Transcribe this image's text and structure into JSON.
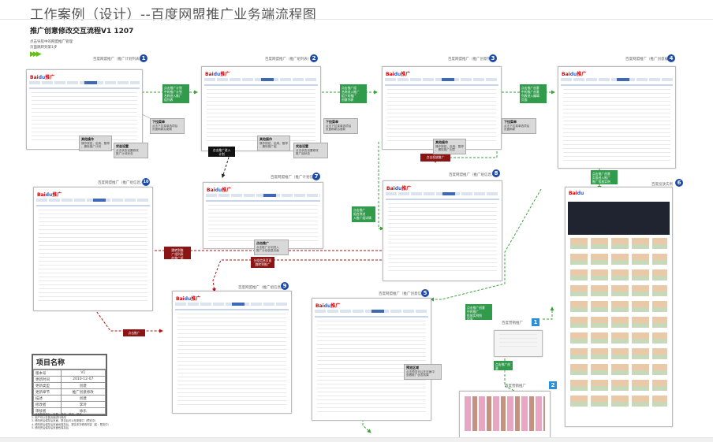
{
  "page": {
    "title": "工作案例（设计）--百度网盟推广业务端流程图",
    "subtitle": "推广创意修改交互流程V1  1207",
    "hint_line1": "点击导航中的网盟推广管理",
    "hint_line2": "页面跳转到第1步",
    "legend_arrows": "▶▶▶"
  },
  "screens": [
    {
      "id": "s1",
      "badge": "1",
      "caption": "百度网盟推广（推广计划列表）"
    },
    {
      "id": "s2",
      "badge": "2",
      "caption": "百度网盟推广（推广组列表）"
    },
    {
      "id": "s3",
      "badge": "3",
      "caption": "百度网盟推广（推广创意列表）"
    },
    {
      "id": "s4",
      "badge": "4",
      "caption": "百度网盟推广（推广创意编辑）"
    },
    {
      "id": "s6",
      "badge": "6",
      "caption": "百度投放实例"
    },
    {
      "id": "s7",
      "badge": "7",
      "caption": "百度网盟推广（推广计划信息）"
    },
    {
      "id": "s8",
      "badge": "8",
      "caption": "百度网盟推广（推广组信息）"
    },
    {
      "id": "s10",
      "badge": "10",
      "caption": "百度网盟推广（推广组信息）"
    },
    {
      "id": "s9",
      "badge": "9",
      "caption": "百度网盟推广（推广组信息）"
    },
    {
      "id": "s5",
      "badge": "5",
      "caption": "百度网盟推广（推广创意信息）"
    },
    {
      "id": "s1b",
      "badge": "1",
      "caption": "百度营销推广"
    },
    {
      "id": "s2b",
      "badge": "2",
      "caption": "百度营销推广"
    }
  ],
  "logo": {
    "text_a": "Bai",
    "text_b": "du",
    "suffix": "推广"
  },
  "green_boxes": {
    "g1": "点击推广计划\n中的推广计划\n名称进入推广\n组列表",
    "g2": "点击推广组\n名称进入推广\n组下的推广\n创意列表",
    "g3": "点击推广创意\n中的推广创意\n列表进入编辑\n页面",
    "g4": "点击推广创意\n页面进入推广\n推广投放实例",
    "g5": "点击推广\n组名称进\n入推广组详情",
    "g6": "点击推广创意\n中的推广\n投放实例到\n页面",
    "g7": "点击推广创意\n的推广创意\n编辑"
  },
  "red_boxes": {
    "r1": "点击投放推广",
    "r2": "跳转到推\n广组列表\n的推广组",
    "r3": "分组信息页面\n跳转到推广",
    "r4": "点击推广"
  },
  "black_boxes": {
    "k1": "点击推广进入\n计划"
  },
  "callouts": {
    "c1_title": "下拉菜单",
    "c1_text": "点击下拉菜单选项后\n页面刷新后更新",
    "c2_title": "其他操作",
    "c2_text": "操作按钮，启用、暂停\n、删除推广计划",
    "c3_title": "状态设置",
    "c3_text": "点击状态设置修改\n推广计划状态",
    "c4_title": "下拉菜单",
    "c4_text": "点击下拉菜单选项后\n页面刷新后更新",
    "c5_title": "其他操作",
    "c5_text": "操作按钮，启用、暂停\n、删除推广组",
    "c6_title": "状态设置",
    "c6_text": "点击状态设置修改\n推广组状态",
    "c7_title": "下拉菜单",
    "c7_text": "点击下拉菜单选项后\n页面刷新",
    "c8_title": "其他操作",
    "c8_text": "操作按钮，启用、暂停\n、删除推广创意",
    "c9_title": "点击推广",
    "c9_text": "点击推广计划进入\n推广计划信息页面",
    "c10_title": "预览区域",
    "c10_text": "点击预览可以在页面中\n查看推广创意效果"
  },
  "info": {
    "head": "项目名称",
    "rows": [
      [
        "版本号",
        "V1"
      ],
      [
        "更新时间",
        "2010-12-07"
      ],
      [
        "更新类型",
        "创建"
      ],
      [
        "更新章节",
        "推广创意修改"
      ],
      [
        "描述",
        "创建"
      ],
      [
        "修改者",
        "李玲"
      ],
      [
        "审核者",
        "徐乐"
      ]
    ],
    "notes": "1. 请参照各部分，标题、修改、修改、修改\n2. 用户可以在各页面进行修改\n3. 修改完后保存后页面，提交后可以在新窗口（预览中）\n4. 修改完后保存后页面也保存后，提交本次修改内容（如：预览中）\n5. 修改完后保存后页面也保存后"
  },
  "colors": {
    "accent_green": "#2f9b4b",
    "accent_red": "#8b1414",
    "badge_blue": "#1e4aa8",
    "arrow_green": "#3aa23a",
    "arrow_red": "#b31212"
  }
}
